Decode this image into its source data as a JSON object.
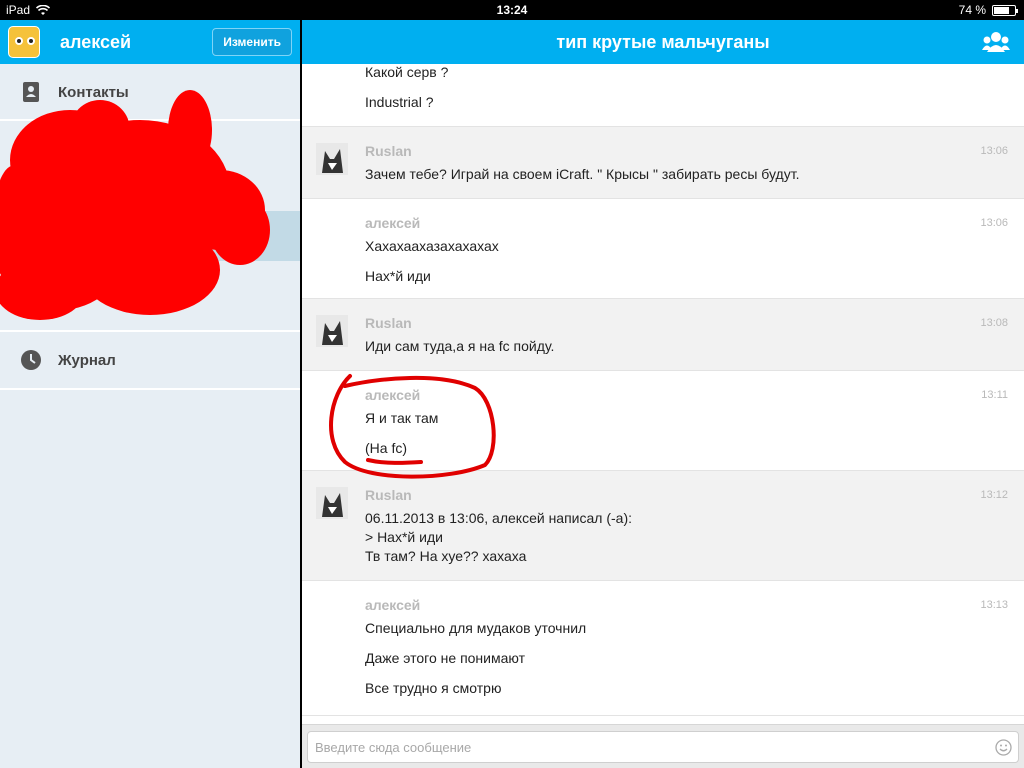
{
  "status_bar": {
    "device": "iPad",
    "time": "13:24",
    "battery": "74 %",
    "battery_level": 0.74
  },
  "sidebar": {
    "user_name": "алексей",
    "edit_label": "Изменить",
    "items": [
      {
        "label": "Контакты",
        "icon": "contacts-book-icon"
      },
      {
        "label": "Журнал",
        "icon": "clock-icon"
      }
    ]
  },
  "chat": {
    "title": "тип крутые мальчуганы",
    "messages": [
      {
        "author": "",
        "time": "",
        "lines": [
          "Какой серв ?",
          "Industrial ?"
        ]
      },
      {
        "author": "Ruslan",
        "time": "13:06",
        "lines": [
          "Зачем тебе? Играй на своем iCraft. \" Крысы \" забирать ресы будут."
        ]
      },
      {
        "author": "алексей",
        "time": "13:06",
        "lines": [
          "Хахахаахазахахахах",
          "Нах*й иди"
        ]
      },
      {
        "author": "Ruslan",
        "time": "13:08",
        "lines": [
          "Иди сам туда,а я на fc пойду."
        ]
      },
      {
        "author": "алексей",
        "time": "13:11",
        "lines": [
          "Я и так там",
          "(На fc)"
        ]
      },
      {
        "author": "Ruslan",
        "time": "13:12",
        "lines": [
          "06.11.2013 в 13:06, алексей написал (-а):",
          "> Нах*й иди",
          "Тв там? На хуе?? хахаха"
        ]
      },
      {
        "author": "алексей",
        "time": "13:13",
        "lines": [
          "Специально для мудаков уточнил",
          "Даже этого не понимают",
          "Все трудно я смотрю"
        ]
      }
    ],
    "input_placeholder": "Введите сюда сообщение"
  },
  "colors": {
    "accent": "#00aff0",
    "redaction": "#ff0000",
    "annotation": "#e00000"
  }
}
